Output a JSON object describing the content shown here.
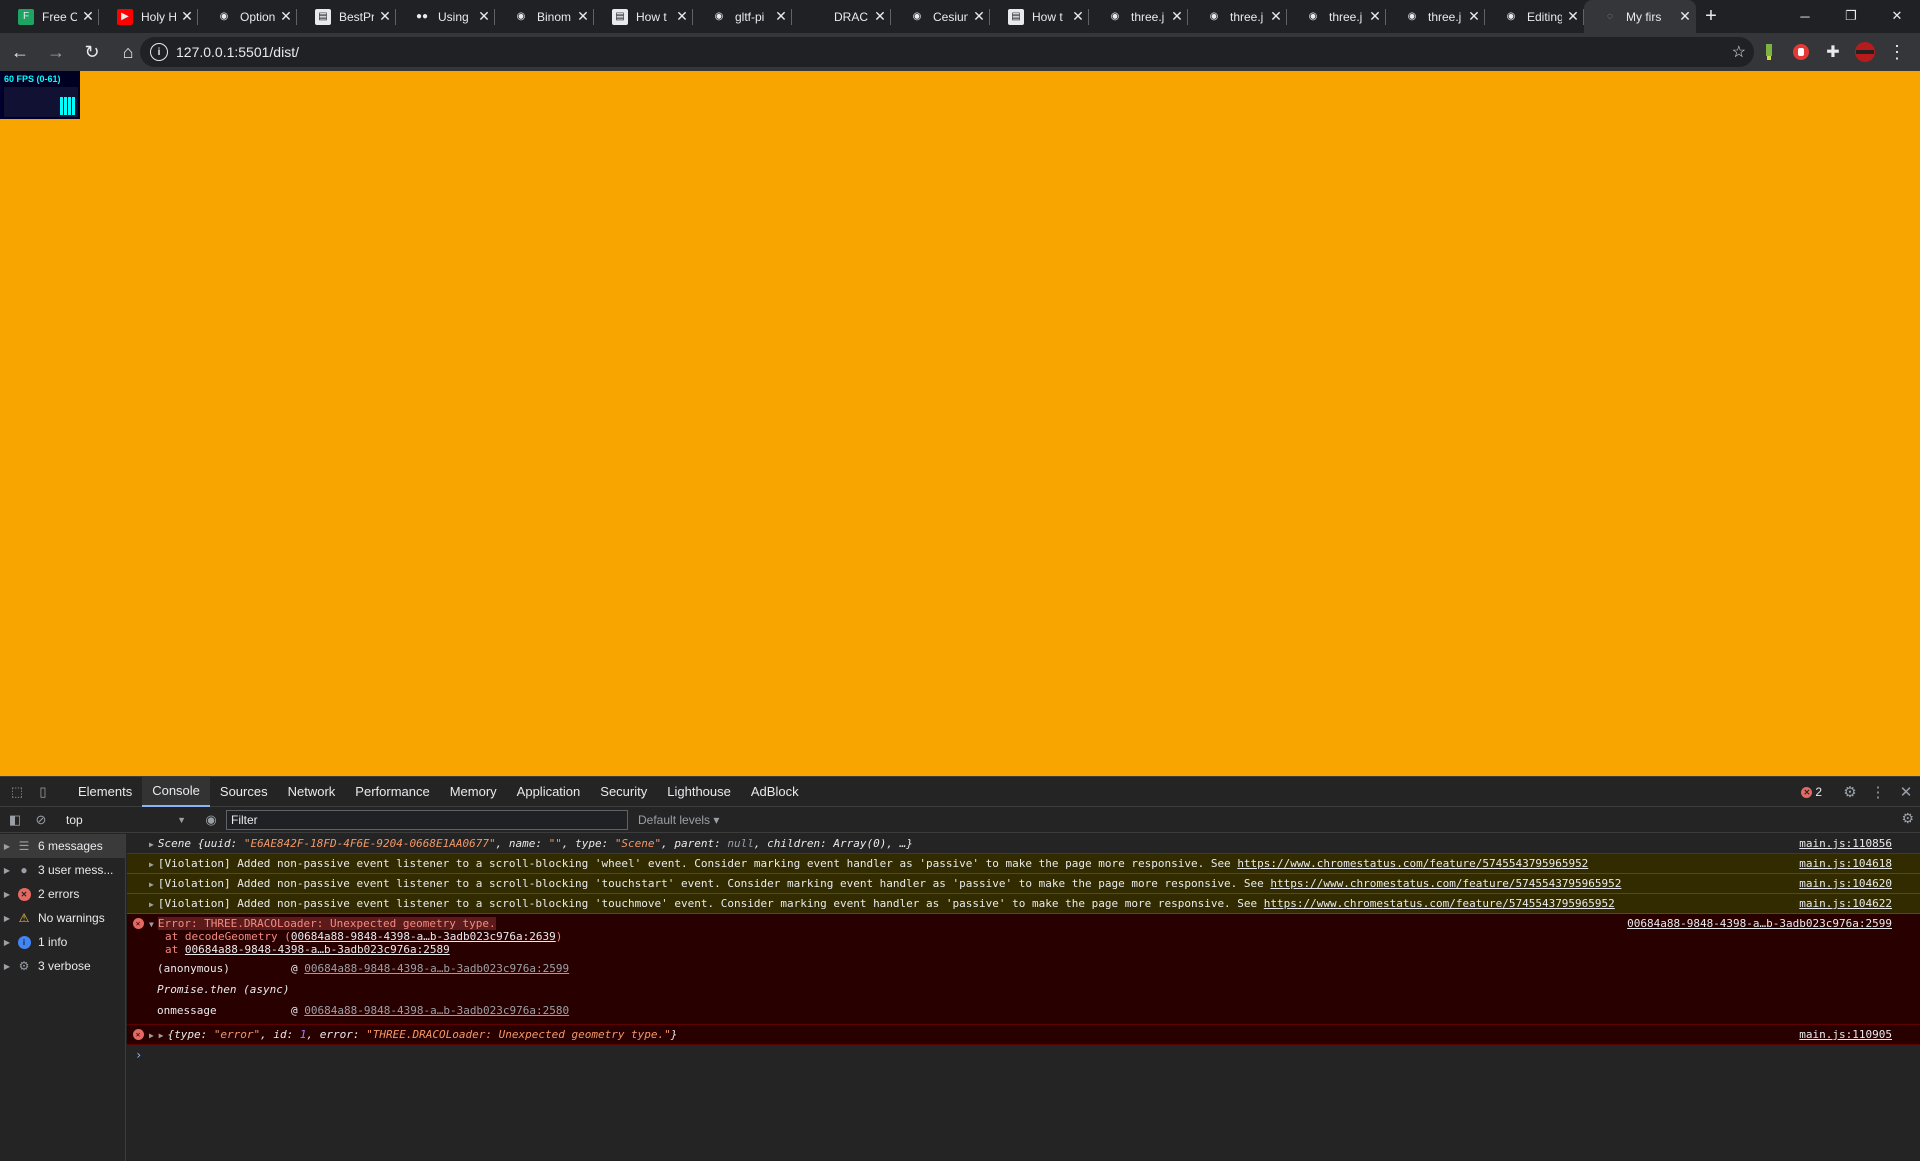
{
  "browser": {
    "tabs": [
      {
        "title": "Free O",
        "fav_color": "#1da462",
        "fav_glyph": "F"
      },
      {
        "title": "Holy H",
        "fav_color": "#ff0000",
        "fav_glyph": "▶"
      },
      {
        "title": "Option",
        "fav_color": "#202124",
        "fav_glyph": "◉"
      },
      {
        "title": "BestPr",
        "fav_color": "#e8eaed",
        "fav_glyph": "▤"
      },
      {
        "title": "Using",
        "fav_color": "#202124",
        "fav_glyph": "●●"
      },
      {
        "title": "Binom",
        "fav_color": "#202124",
        "fav_glyph": "◉"
      },
      {
        "title": "How t",
        "fav_color": "#e8eaed",
        "fav_glyph": "▤"
      },
      {
        "title": "gltf-pi",
        "fav_color": "#202124",
        "fav_glyph": "◉"
      },
      {
        "title": "DRAC",
        "fav_color": "#202124",
        "fav_glyph": ""
      },
      {
        "title": "Cesiun",
        "fav_color": "#202124",
        "fav_glyph": "◉"
      },
      {
        "title": "How t",
        "fav_color": "#e8eaed",
        "fav_glyph": "▤"
      },
      {
        "title": "three.j",
        "fav_color": "#202124",
        "fav_glyph": "◉"
      },
      {
        "title": "three.j",
        "fav_color": "#202124",
        "fav_glyph": "◉"
      },
      {
        "title": "three.j",
        "fav_color": "#202124",
        "fav_glyph": "◉"
      },
      {
        "title": "three.j",
        "fav_color": "#202124",
        "fav_glyph": "◉"
      },
      {
        "title": "Editing",
        "fav_color": "#202124",
        "fav_glyph": "◉"
      }
    ],
    "active_tab": {
      "title": "My firs",
      "fav_glyph": "◌"
    },
    "close_glyph": "✕",
    "new_tab_glyph": "+",
    "window_controls": {
      "minimize": "─",
      "restore": "❐",
      "close": "✕"
    },
    "url": "127.0.0.1:5501/dist/",
    "nav": {
      "back": "←",
      "forward": "→",
      "reload": "↻",
      "home": "⌂"
    },
    "bookmark_glyph": "☆",
    "menu_glyph": "⋮"
  },
  "viewport": {
    "background": "#f8a500",
    "fps_label": "60 FPS (0-61)"
  },
  "devtools": {
    "tabs": [
      "Elements",
      "Console",
      "Sources",
      "Network",
      "Performance",
      "Memory",
      "Application",
      "Security",
      "Lighthouse",
      "AdBlock"
    ],
    "active_tab": "Console",
    "error_count": "2",
    "context": "top",
    "filter_placeholder": "Filter",
    "levels_label": "Default levels ▾",
    "sidebar": [
      {
        "label": "6 messages",
        "icon": "list-icon",
        "glyph": "☰",
        "color": "#9aa0a6",
        "selected": true
      },
      {
        "label": "3 user mess...",
        "icon": "user-icon",
        "glyph": "●",
        "color": "#9aa0a6",
        "selected": false
      },
      {
        "label": "2 errors",
        "icon": "error-icon",
        "glyph": "✕",
        "color": "#e46962",
        "selected": false
      },
      {
        "label": "No warnings",
        "icon": "warning-icon",
        "glyph": "⚠",
        "color": "#f2c94c",
        "selected": false
      },
      {
        "label": "1 info",
        "icon": "info-icon",
        "glyph": "i",
        "color": "#4285f4",
        "selected": false
      },
      {
        "label": "3 verbose",
        "icon": "verbose-icon",
        "glyph": "⚙",
        "color": "#9aa0a6",
        "selected": false
      }
    ],
    "console": {
      "scene_log": {
        "prefix": "Scene {uuid: ",
        "uuid": "\"E6AE842F-18FD-4F6E-9204-0668E1AA0677\"",
        "mid1": ", name: ",
        "name": "\"\"",
        "mid2": ", type: ",
        "type": "\"Scene\"",
        "mid3": ", parent: ",
        "parent": "null",
        "suffix": ", children: Array(0), …}",
        "source": "main.js:110856"
      },
      "violations": [
        {
          "text": "[Violation] Added non-passive event listener to a scroll-blocking 'wheel' event. Consider marking event handler as 'passive' to make the page more responsive. See ",
          "link": "https://www.chromestatus.com/feature/5745543795965952",
          "source": "main.js:104618"
        },
        {
          "text": "[Violation] Added non-passive event listener to a scroll-blocking 'touchstart' event. Consider marking event handler as 'passive' to make the page more responsive. See ",
          "link": "https://www.chromestatus.com/feature/5745543795965952",
          "source": "main.js:104620"
        },
        {
          "text": "[Violation] Added non-passive event listener to a scroll-blocking 'touchmove' event. Consider marking event handler as 'passive' to make the page more responsive. See ",
          "link": "https://www.chromestatus.com/feature/5745543795965952",
          "source": "main.js:104622"
        }
      ],
      "error1": {
        "message": "Error: THREE.DRACOLoader: Unexpected geometry type.",
        "source": "00684a88-9848-4398-a…b-3adb023c976a:2599",
        "stack": [
          {
            "prefix": "at decodeGeometry (",
            "link": "00684a88-9848-4398-a…b-3adb023c976a:2639",
            "suffix": ")"
          },
          {
            "prefix": "at ",
            "link": "00684a88-9848-4398-a…b-3adb023c976a:2589",
            "suffix": ""
          }
        ],
        "async_frames": [
          {
            "fn": "(anonymous)",
            "at": "@",
            "link": "00684a88-9848-4398-a…b-3adb023c976a:2599"
          },
          {
            "fn": "Promise.then (async)",
            "at": "",
            "link": ""
          },
          {
            "fn": "onmessage",
            "at": "@",
            "link": "00684a88-9848-4398-a…b-3adb023c976a:2580"
          }
        ]
      },
      "error2": {
        "prefix": "{type: ",
        "type": "\"error\"",
        "mid1": ", id: ",
        "id": "1",
        "mid2": ", error: ",
        "error": "\"THREE.DRACOLoader: Unexpected geometry type.\"",
        "suffix": "}",
        "source": "main.js:110905"
      },
      "prompt": "›"
    }
  }
}
